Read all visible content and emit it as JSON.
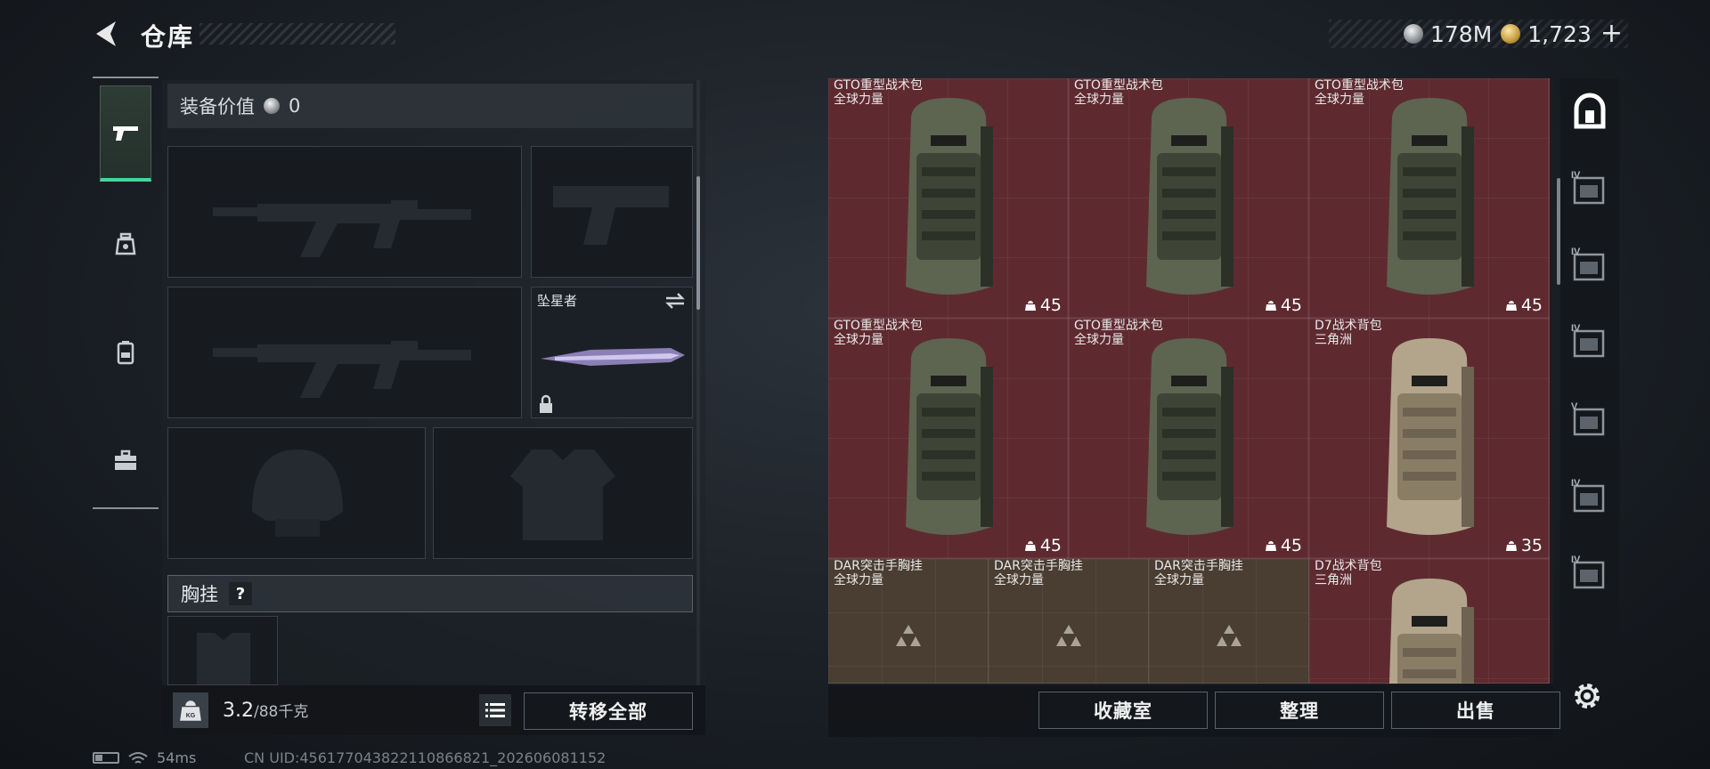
{
  "header": {
    "title": "仓库",
    "currency_silver": "178M",
    "currency_gold": "1,723",
    "add_symbol": "+"
  },
  "left_nav": {
    "tabs": [
      "pistol-icon",
      "grenade-icon",
      "backpack-icon",
      "toolbox-icon"
    ],
    "active": 0
  },
  "equipment": {
    "value_label": "装备价值",
    "value": "0",
    "melee_name": "坠星者",
    "chest_rig_label": "胸挂",
    "help": "?",
    "weight_current": "3.2",
    "weight_max": "/88千克",
    "weight_icon_label": "KG",
    "transfer_all": "转移全部"
  },
  "grid": {
    "items": [
      {
        "name": "GTO重型战术包",
        "sub": "全球力量",
        "count": "45",
        "kind": "bag",
        "tone": "green"
      },
      {
        "name": "GTO重型战术包",
        "sub": "全球力量",
        "count": "45",
        "kind": "bag",
        "tone": "green"
      },
      {
        "name": "GTO重型战术包",
        "sub": "全球力量",
        "count": "45",
        "kind": "bag",
        "tone": "green"
      },
      {
        "name": "GTO重型战术包",
        "sub": "全球力量",
        "count": "45",
        "kind": "bag",
        "tone": "green"
      },
      {
        "name": "GTO重型战术包",
        "sub": "全球力量",
        "count": "45",
        "kind": "bag",
        "tone": "green"
      },
      {
        "name": "D7战术背包",
        "sub": "三角洲",
        "count": "35",
        "kind": "bag",
        "tone": "tan"
      },
      {
        "name": "DAR突击手胸挂",
        "sub": "全球力量",
        "kind": "rig"
      },
      {
        "name": "DAR突击手胸挂",
        "sub": "全球力量",
        "kind": "rig"
      },
      {
        "name": "DAR突击手胸挂",
        "sub": "全球力量",
        "kind": "rig"
      },
      {
        "name": "D7战术背包",
        "sub": "三角洲",
        "kind": "bag",
        "tone": "tan"
      }
    ]
  },
  "actions": {
    "collection": "收藏室",
    "sort": "整理",
    "sell": "出售"
  },
  "right_nav": {
    "items": [
      "safe-icon",
      "IV",
      "IV",
      "IV",
      "V",
      "IV",
      "IV"
    ]
  },
  "status": {
    "ping": "54ms",
    "uid": "CN UID:456177043822110866821_202606081152"
  },
  "colors": {
    "accent": "#47d39a",
    "red_cell": "#5e2a30",
    "brown_cell": "#4a3d31"
  }
}
